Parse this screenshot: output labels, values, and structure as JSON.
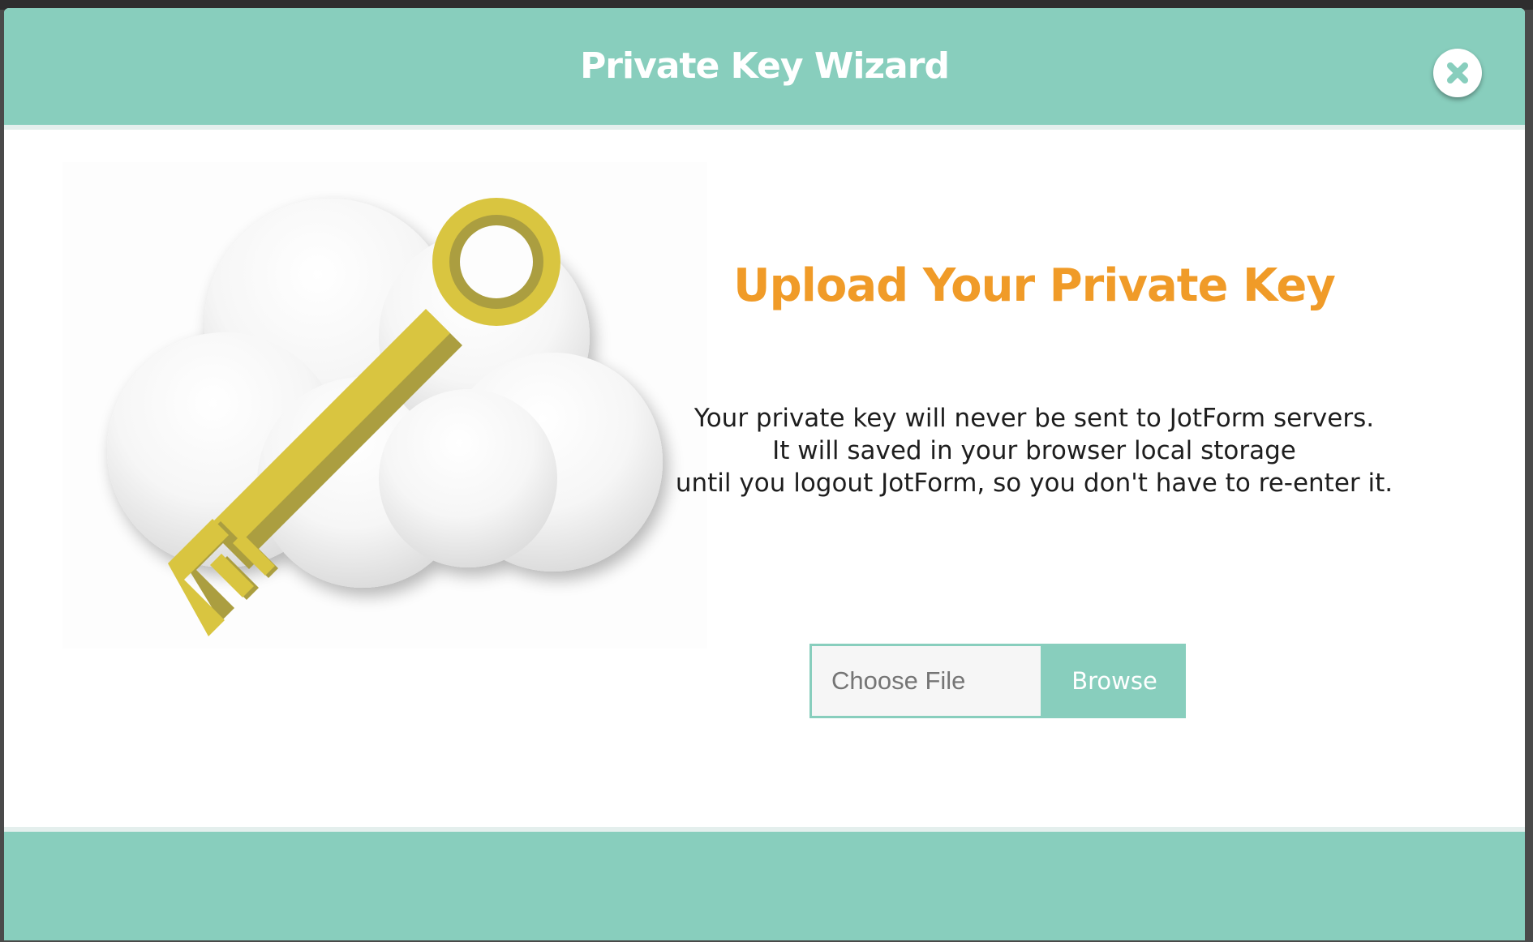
{
  "modal": {
    "title": "Private Key Wizard",
    "close_icon": "close-x-icon",
    "illustration": "cloud-key-illustration"
  },
  "content": {
    "heading": "Upload Your Private Key",
    "description_lines": [
      "Your private key will never be sent to JotForm servers.",
      "It will saved in your browser local storage",
      "until you logout JotForm, so you don't have to re-enter it."
    ]
  },
  "file_picker": {
    "placeholder": "Choose File",
    "value": "",
    "browse_label": "Browse"
  },
  "colors": {
    "accent": "#88cebd",
    "heading": "#f09b28",
    "key": "#d9c540",
    "key_shadow": "#ab9e40"
  }
}
